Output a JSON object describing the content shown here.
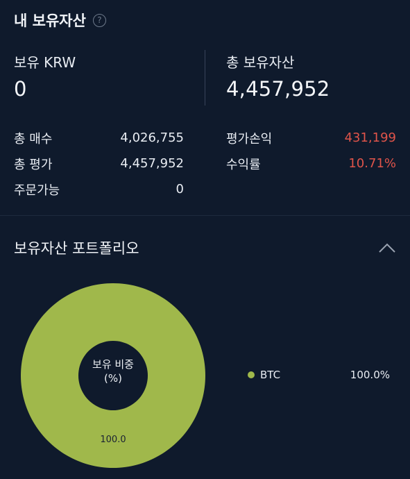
{
  "header": {
    "title": "내 보유자산",
    "help_icon": "question-circle-icon"
  },
  "holdings_krw": {
    "label": "보유 KRW",
    "value": "0"
  },
  "total_assets": {
    "label": "총 보유자산",
    "value": "4,457,952"
  },
  "summary_left": [
    {
      "label": "총 매수",
      "value": "4,026,755"
    },
    {
      "label": "총 평가",
      "value": "4,457,952"
    },
    {
      "label": "주문가능",
      "value": "0"
    }
  ],
  "summary_right": [
    {
      "label": "평가손익",
      "value": "431,199"
    },
    {
      "label": "수익률",
      "value": "10.71%"
    }
  ],
  "portfolio": {
    "title": "보유자산 포트폴리오",
    "collapse_icon": "chevron-up-icon",
    "center_label_line1": "보유 비중",
    "center_label_line2": "(%)"
  },
  "colors": {
    "accent_green": "#a0b84b",
    "negative_red": "#e0544a",
    "background": "#0f1a2c"
  },
  "chart_data": {
    "type": "pie",
    "categories": [
      "BTC"
    ],
    "values": [
      100.0
    ],
    "slice_labels": [
      "100.0"
    ],
    "legend": [
      {
        "name": "BTC",
        "percent": "100.0%"
      }
    ],
    "legend_position": "right"
  }
}
